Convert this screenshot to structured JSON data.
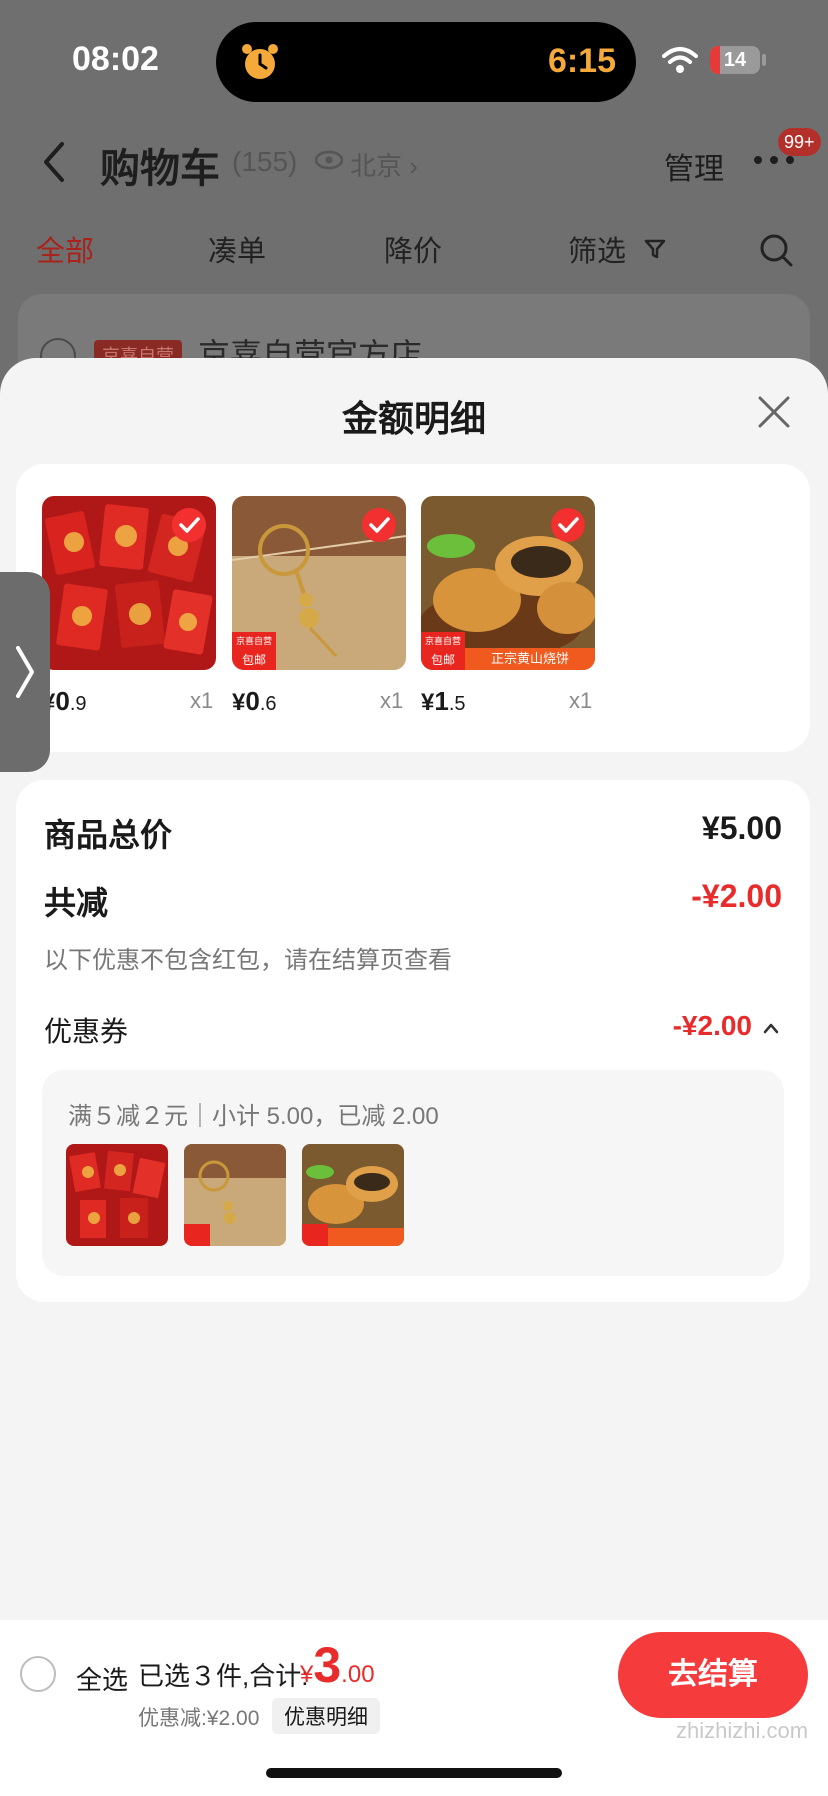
{
  "status_bar": {
    "time": "08:02",
    "island_time": "6:15",
    "battery": "14"
  },
  "header": {
    "title": "购物车",
    "count": "(155)",
    "location": "北京",
    "manage": "管理",
    "badge": "99+"
  },
  "tabs": [
    {
      "label": "全部",
      "active": true
    },
    {
      "label": "凑单",
      "active": false
    },
    {
      "label": "降价",
      "active": false
    },
    {
      "label": "筛选",
      "active": false
    }
  ],
  "store": {
    "tag": "京喜自营",
    "name": "京喜自营官方店"
  },
  "sheet": {
    "title": "金额明细",
    "items": [
      {
        "currency": "¥",
        "price_int": "0",
        "price_dec": ".9",
        "qty": "x1",
        "name": "red-envelopes",
        "tags": []
      },
      {
        "currency": "¥",
        "price_int": "0",
        "price_dec": ".6",
        "qty": "x1",
        "name": "keychain",
        "tags": [
          "京喜自营",
          "包邮"
        ]
      },
      {
        "currency": "¥",
        "price_int": "1",
        "price_dec": ".5",
        "qty": "x1",
        "name": "huangshan-shaobing",
        "tags": [
          "京喜自营",
          "包邮",
          "正宗黄山烧饼"
        ]
      }
    ],
    "summary": {
      "total_label": "商品总价",
      "total_value": "¥5.00",
      "discount_label": "共减",
      "discount_value": "-¥2.00",
      "discount_note": "以下优惠不包含红包，请在结算页查看",
      "coupon_label": "优惠券",
      "coupon_value": "-¥2.00",
      "coupon_desc": "满５减２元｜小计 5.00，已减 2.00"
    }
  },
  "bottom": {
    "select_all": "全选",
    "selected": "已选３件,合计:",
    "total_currency": "¥",
    "total_int": "3",
    "total_dec": ".00",
    "discount": "优惠减:¥2.00",
    "detail": "优惠明细",
    "checkout": "去结算",
    "watermark": "zhizhizhi.com"
  },
  "colors": {
    "accent": "#f53b3b",
    "price_red": "#e82b2b",
    "island_orange": "#f4a93a"
  }
}
